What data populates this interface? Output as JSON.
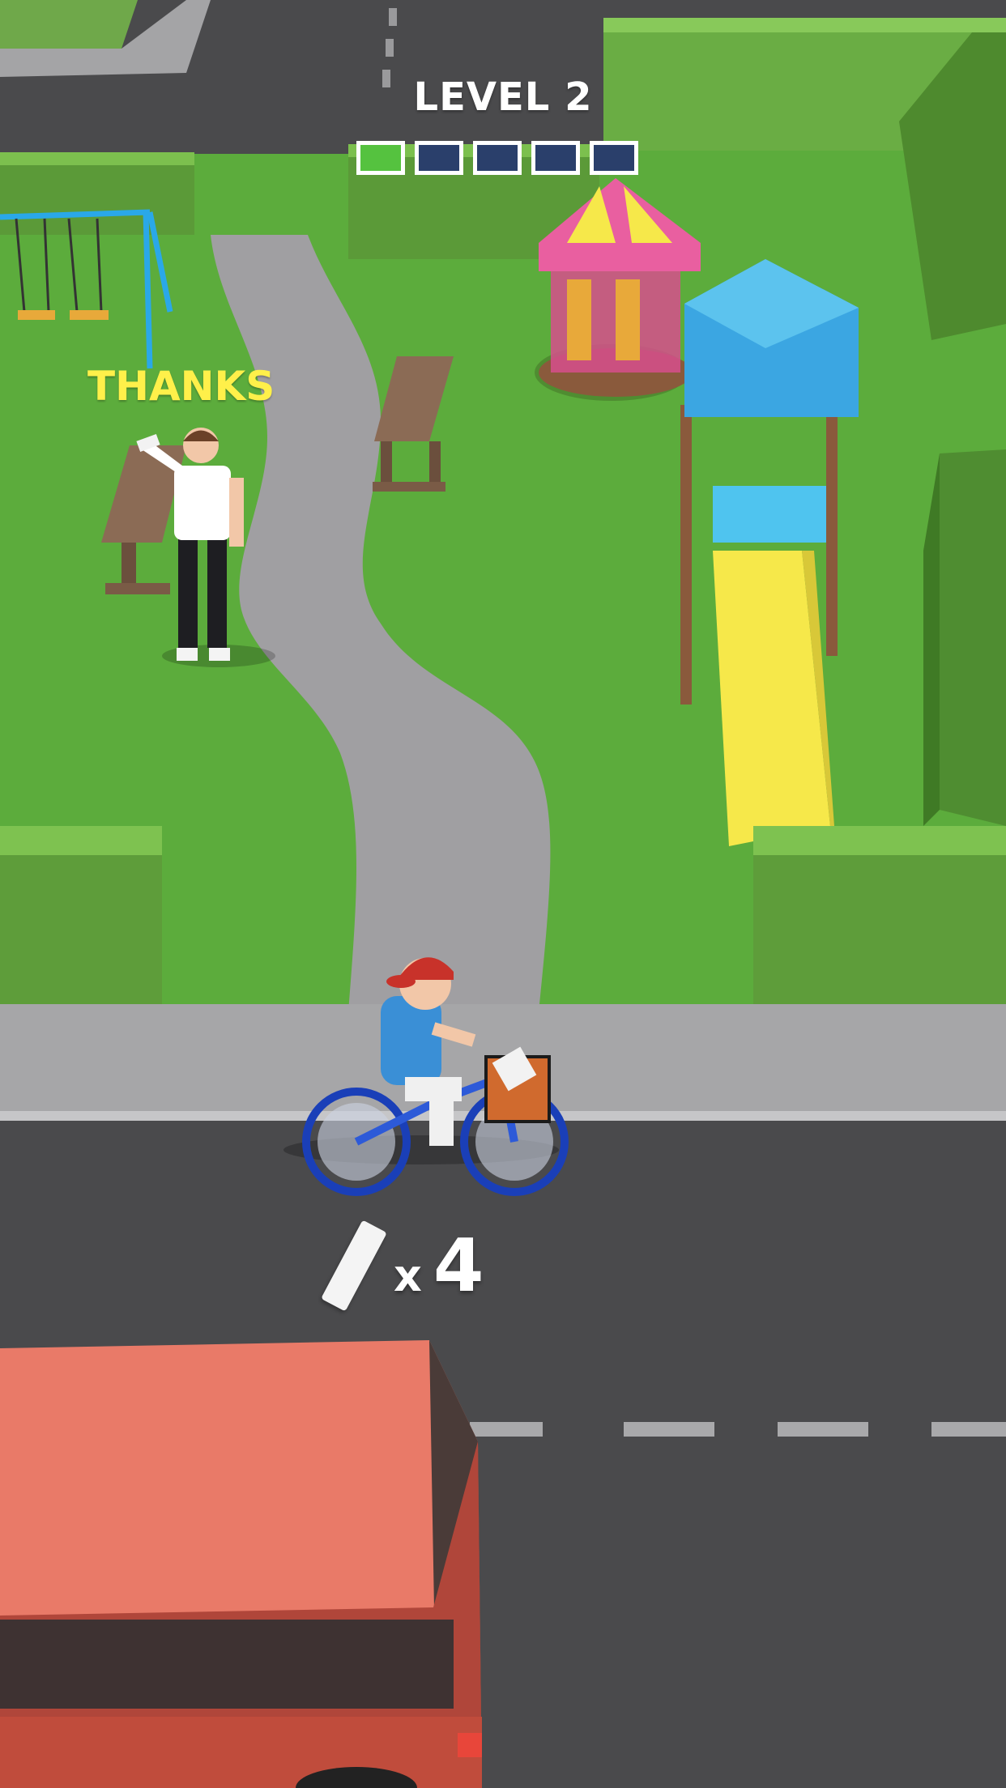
{
  "hud": {
    "level_label": "LEVEL 2",
    "progress": {
      "completed": 1,
      "total": 5
    },
    "colors": {
      "done": "#55c23f",
      "pending": "#2a3f6b",
      "border": "#ffffff"
    }
  },
  "scene": {
    "npc_message": "THANKS",
    "npc_message_color": "#fff04a"
  },
  "inventory": {
    "item_icon": "newspaper-icon",
    "multiplier_label": "x",
    "count": "4"
  }
}
